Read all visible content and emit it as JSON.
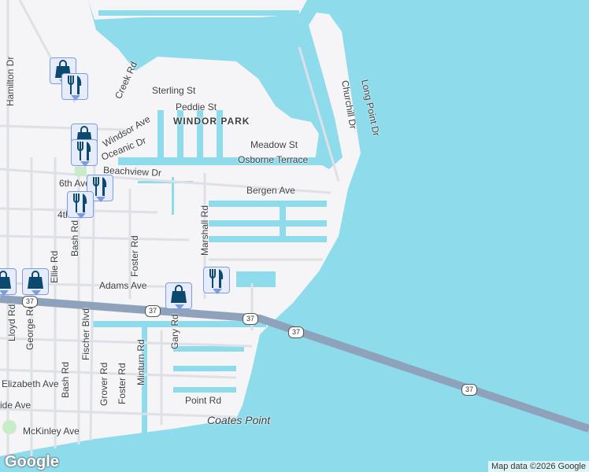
{
  "map": {
    "colors": {
      "water": "#8edbec",
      "land": "#f5f4f6",
      "road": "#dde1e7",
      "highway": "#8fa2bc",
      "canal": "#8edbec",
      "park": "#c8ebc8"
    }
  },
  "labels": {
    "hamilton": "Hamilton Dr",
    "creek": "Creek Rd",
    "sterling": "Sterling St",
    "peddie": "Peddie St",
    "windor": "WINDOR PARK",
    "windsor": "Windsor Ave",
    "oceanic": "Oceanic Dr",
    "meadow": "Meadow St",
    "osborne": "Osborne Terrace",
    "beachview": "Beachview Dr",
    "bergen": "Bergen Ave",
    "sixth": "6th Ave",
    "fourth": "4th",
    "churchill": "Churchill Dr",
    "longpoint": "Long Point Dr",
    "marshall": "Marshall Rd",
    "foster1": "Foster Rd",
    "bash1": "Bash Rd",
    "ellie": "Ellie Rd",
    "adams": "Adams Ave",
    "lloyd": "Lloyd Rd",
    "george": "George Rd",
    "fischer": "Fischer Blvd",
    "gary": "Gary Rd",
    "grover": "Grover Rd",
    "foster2": "Foster Rd",
    "minturn": "Minturn Rd",
    "bash2": "Bash Rd",
    "elizabeth": "Elizabeth Ave",
    "ide": "ide Ave",
    "mckinley": "McKinley Ave",
    "point": "Point Rd",
    "coates": "Coates Point"
  },
  "route_shields": [
    "37",
    "37",
    "37",
    "37",
    "37"
  ],
  "markers": [
    {
      "type": "shopping-bag"
    },
    {
      "type": "restaurant"
    },
    {
      "type": "shopping-bag"
    },
    {
      "type": "restaurant"
    },
    {
      "type": "restaurant"
    },
    {
      "type": "restaurant"
    },
    {
      "type": "shopping-bag"
    },
    {
      "type": "shopping-bag"
    },
    {
      "type": "shopping-bag"
    },
    {
      "type": "restaurant"
    }
  ],
  "footer": {
    "logo": "Google",
    "attribution": "Map data ©2026 Google"
  }
}
